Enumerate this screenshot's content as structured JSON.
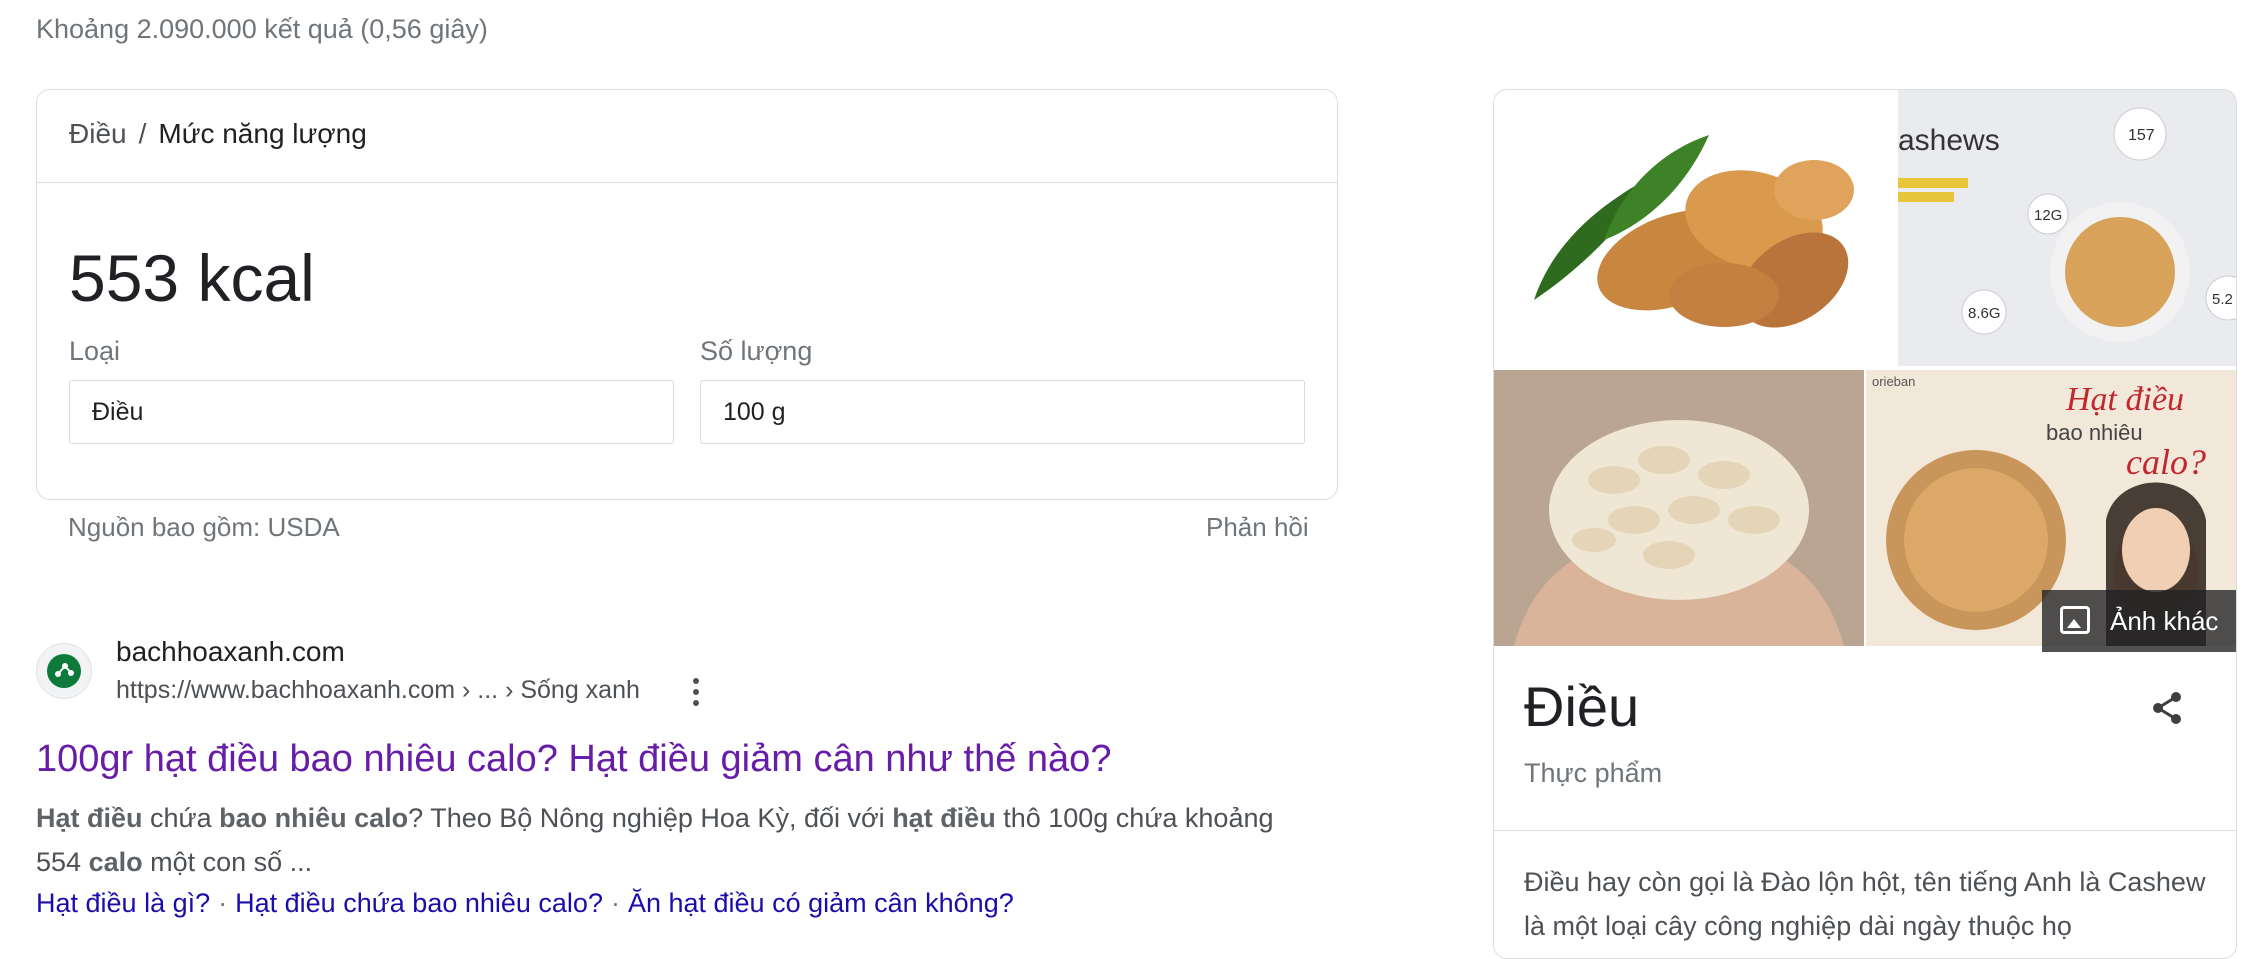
{
  "result_stats": "Khoảng 2.090.000 kết quả (0,56 giây)",
  "calorie_card": {
    "breadcrumb": {
      "first": "Điều",
      "separator": "/",
      "second": "Mức năng lượng"
    },
    "value": "553 kcal",
    "type_label": "Loại",
    "type_value": "Điều",
    "quantity_label": "Số lượng",
    "quantity_value": "100 g",
    "source": "Nguồn bao gồm: USDA",
    "feedback": "Phản hồi"
  },
  "result": {
    "site_name": "bachhoaxanh.com",
    "url": "https://www.bachhoaxanh.com › ... › Sống xanh",
    "title": "100gr hạt điều bao nhiêu calo? Hạt điều giảm cân như thế nào?",
    "snippet_parts": [
      {
        "text": "Hạt điều",
        "bold": true
      },
      {
        "text": " chứa ",
        "bold": false
      },
      {
        "text": "bao nhiêu calo",
        "bold": true
      },
      {
        "text": "? Theo Bộ Nông nghiệp Hoa Kỳ, đối với ",
        "bold": false
      },
      {
        "text": "hạt điều",
        "bold": true
      },
      {
        "text": " thô 100g chứa khoảng 554 ",
        "bold": false
      },
      {
        "text": "calo",
        "bold": true
      },
      {
        "text": " một con số ...",
        "bold": false
      }
    ],
    "sitelinks": [
      "Hạt điều là gì?",
      "Hạt điều chứa bao nhiêu calo?",
      "Ăn hạt điều có giảm cân không?"
    ],
    "sitelink_separator": "·"
  },
  "knowledge_panel": {
    "image_texts": {
      "tile2_heading": "ashews",
      "tile2_cal": "157",
      "tile2_fat": "12G",
      "tile2_carb": "8.6G",
      "tile2_prot": "5.2",
      "tile4_brand": "orieban",
      "tile4_line1": "Hạt điều",
      "tile4_line2": "bao nhiêu",
      "tile4_line3": "calo?"
    },
    "more_images": "Ảnh khác",
    "title": "Điều",
    "subtitle": "Thực phẩm",
    "description": "Điều hay còn gọi là Đào lộn hột, tên tiếng Anh là Cashew là một loại cây công nghiệp dài ngày thuộc họ"
  },
  "colors": {
    "link": "#1a0dab",
    "visited": "#681da8",
    "muted": "#70757a",
    "border": "#dadce0"
  }
}
